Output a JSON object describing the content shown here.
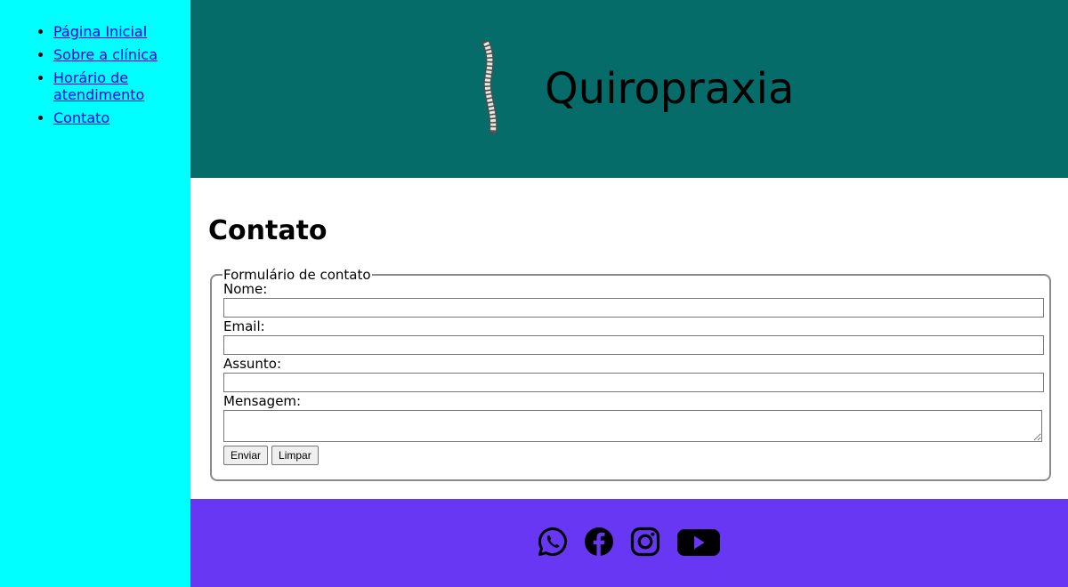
{
  "nav": {
    "items": [
      {
        "label": "Página Inicial"
      },
      {
        "label": "Sobre a clínica"
      },
      {
        "label": "Horário de atendimento"
      },
      {
        "label": "Contato"
      }
    ]
  },
  "header": {
    "title": "Quiropraxia",
    "logo_icon": "spine-icon"
  },
  "main": {
    "heading": "Contato",
    "form": {
      "legend": "Formulário de contato",
      "name_label": "Nome:",
      "name_value": "",
      "email_label": "Email:",
      "email_value": "",
      "subject_label": "Assunto:",
      "subject_value": "",
      "message_label": "Mensagem:",
      "message_value": "",
      "submit_label": "Enviar",
      "reset_label": "Limpar"
    }
  },
  "footer": {
    "social_icons": [
      "whatsapp-icon",
      "facebook-icon",
      "instagram-icon",
      "youtube-icon"
    ]
  },
  "colors": {
    "sidebar_bg": "#00ffff",
    "header_bg": "#056c6a",
    "footer_bg": "#6737f4",
    "link": "#0000ee"
  }
}
